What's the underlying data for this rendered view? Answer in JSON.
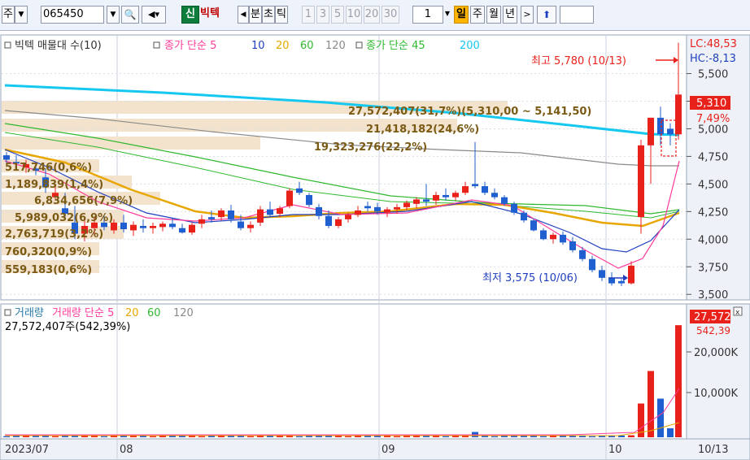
{
  "toolbar": {
    "market": "주",
    "code": "065450",
    "badge": "신",
    "name": "빅텍",
    "periods": [
      "분",
      "초",
      "틱"
    ],
    "intervals": [
      "1",
      "3",
      "5",
      "10",
      "20",
      "30"
    ],
    "count": "1",
    "ranges": [
      "일",
      "주",
      "월",
      "년"
    ],
    "active_range": "일"
  },
  "legend": {
    "volume_profile": "빅텍 매물대 수(10)",
    "ma_title": "종가 단순 5",
    "ma_periods": [
      "10",
      "20",
      "60",
      "120"
    ],
    "ma2_title": "종가 단순 45",
    "ma2_periods": [
      "200"
    ]
  },
  "right_axis": {
    "lc": "LC:48,53",
    "hc": "HC:-8,13",
    "ticks": [
      "5,500",
      "5,250",
      "5,000",
      "4,750",
      "4,500",
      "4,250",
      "4,000",
      "3,750",
      "3,500"
    ],
    "current_price": "5,310",
    "change": "7,49%"
  },
  "annotations": {
    "high": "최고 5,780 (10/13)",
    "low": "최저 3,575 (10/06)"
  },
  "volume_profile": [
    "27,572,407(31,7%)(5,310,00 ~ 5,141,50)",
    "21,418,182(24,6%)",
    "19,323,276(22,2%)",
    "517,746(0,6%)",
    "1,189,839(1,4%)",
    "6,834,656(7,9%)",
    "5,989,032(6,9%)",
    "2,763,719(3,2%)",
    "760,320(0,9%)",
    "559,183(0,6%)"
  ],
  "volume_panel": {
    "legend_title": "거래량 단순 5",
    "legend_periods": [
      "20",
      "60",
      "120"
    ],
    "summary": "27,572,407주(542,39%)",
    "badge_value": "27,572",
    "badge_pct": "542,39",
    "ticks": [
      "20,000K",
      "10,000K"
    ]
  },
  "x_axis": [
    "2023/07",
    "08",
    "09",
    "10",
    "10/13"
  ],
  "colors": {
    "up": "#e8221b",
    "down": "#1f5fcf",
    "ma5": "#ff3b9a",
    "ma10": "#1f3fbf",
    "ma20": "#e8a700",
    "ma60": "#2fb82f",
    "ma120": "#8a8a8a",
    "ma200": "#16c8f0",
    "profile": "#f3e3cc"
  },
  "chart_data": {
    "type": "candlestick",
    "ylim": [
      3450,
      5850
    ],
    "high": 5780,
    "low": 3575,
    "close": 5310,
    "volume_ylim": [
      0,
      28000000
    ],
    "volume_last": 27572407
  }
}
